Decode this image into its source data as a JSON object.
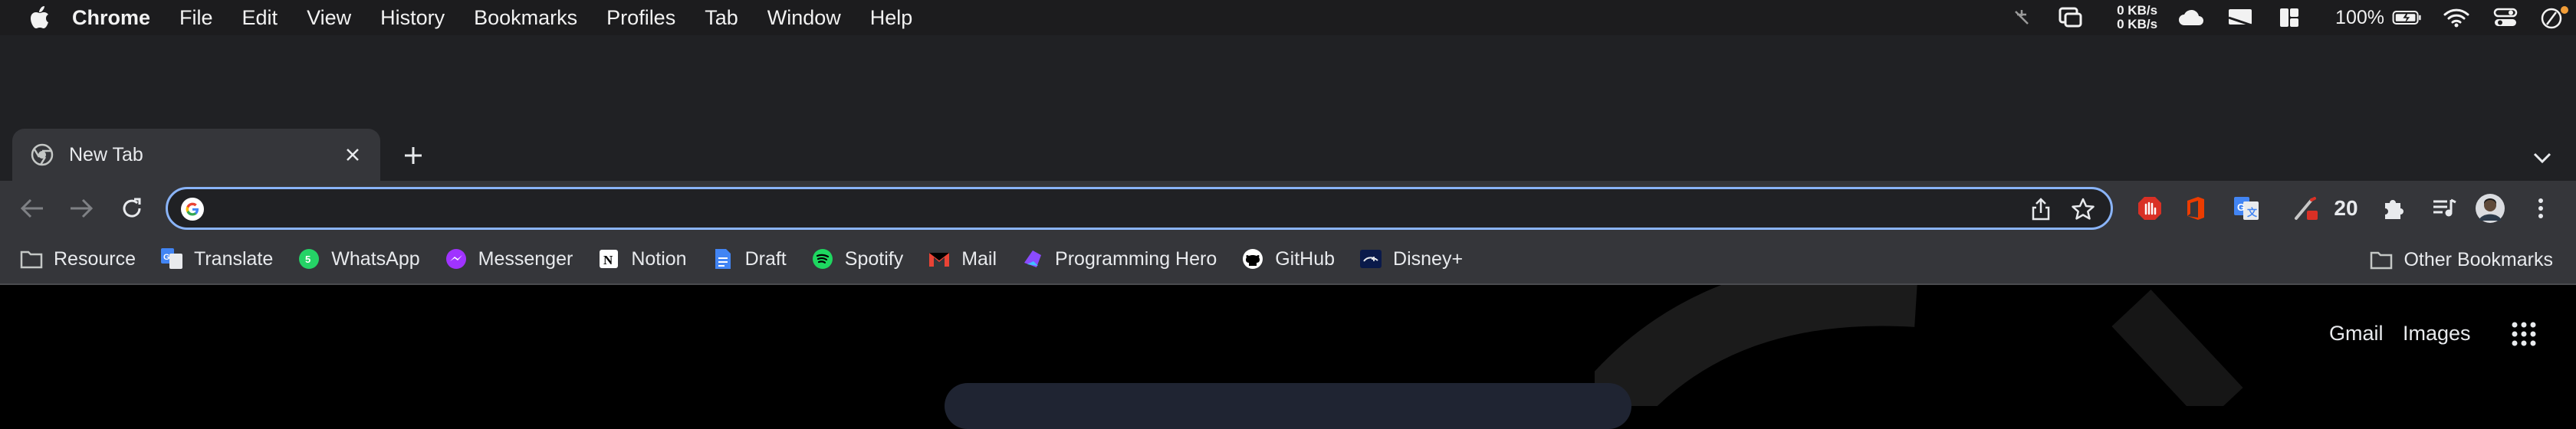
{
  "menubar": {
    "app_name": "Chrome",
    "items": [
      "File",
      "Edit",
      "View",
      "History",
      "Bookmarks",
      "Profiles",
      "Tab",
      "Window",
      "Help"
    ],
    "net_up": "0 KB/s",
    "net_down": "0 KB/s",
    "battery": "100%"
  },
  "tab": {
    "title": "New Tab"
  },
  "omnibox": {
    "value": "",
    "placeholder": ""
  },
  "extensions": {
    "badge_count": "20"
  },
  "bookmarks": {
    "items": [
      "Resource",
      "Translate",
      "WhatsApp",
      "Messenger",
      "Notion",
      "Draft",
      "Spotify",
      "Mail",
      "Programming Hero",
      "GitHub",
      "Disney+"
    ],
    "other": "Other Bookmarks"
  },
  "page": {
    "gmail": "Gmail",
    "images": "Images"
  },
  "colors": {
    "accent": "#8ab4f8",
    "toolbar": "#35363a",
    "tabstrip": "#202124"
  }
}
